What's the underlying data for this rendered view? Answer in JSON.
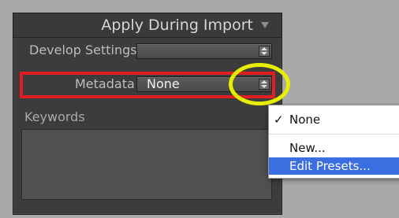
{
  "panel": {
    "title": "Apply During Import"
  },
  "develop_settings": {
    "label": "Develop Settings",
    "value": ""
  },
  "metadata": {
    "label": "Metadata",
    "value": "None"
  },
  "keywords": {
    "label": "Keywords",
    "value": ""
  },
  "menu": {
    "items": [
      {
        "label": "None",
        "checked": true,
        "highlighted": false
      },
      {
        "label": "New...",
        "checked": false,
        "highlighted": false
      },
      {
        "label": "Edit Presets...",
        "checked": false,
        "highlighted": true
      }
    ],
    "check_glyph": "✓"
  },
  "annotations": {
    "highlight_box_color": "#e02020",
    "circle_color": "#e8ee00"
  }
}
